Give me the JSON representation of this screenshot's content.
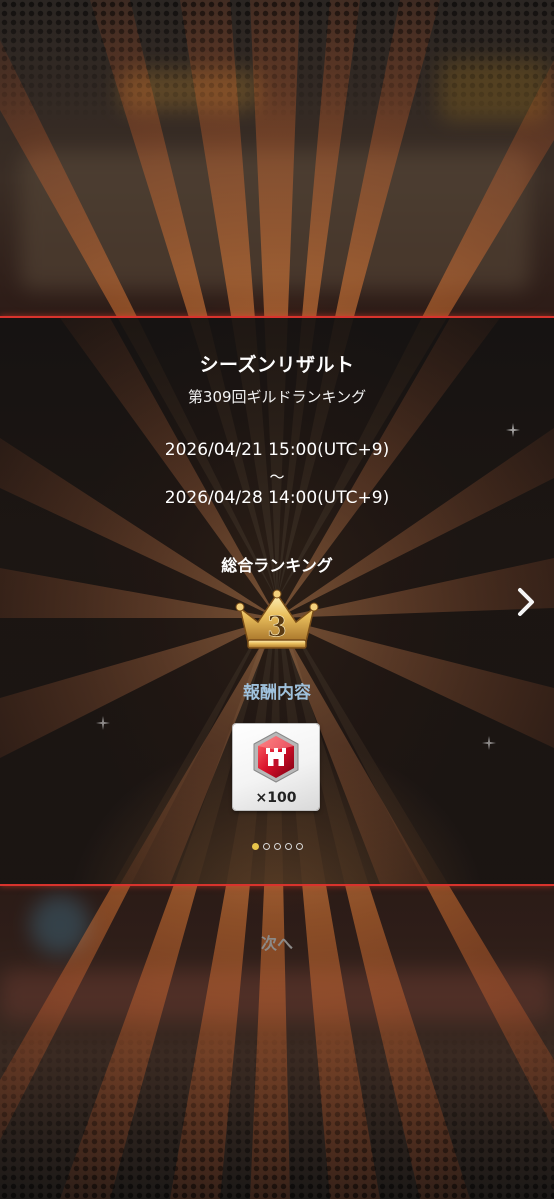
{
  "result": {
    "title": "シーズンリザルト",
    "subtitle": "第309回ギルドランキング",
    "period_start": "2026/04/21 15:00(UTC+9)",
    "period_separator": "～",
    "period_end": "2026/04/28 14:00(UTC+9)",
    "ranking_label": "総合ランキング",
    "rank": "3",
    "reward_label": "報酬内容",
    "reward": {
      "icon": "guild-castle-gem-icon",
      "quantity": "×100"
    },
    "pager": {
      "total": 5,
      "current": 1
    }
  },
  "footer": {
    "next_label": "次へ"
  },
  "colors": {
    "accent_red": "#d8332d",
    "reward_label": "#9fc1dc",
    "crown_gold": "#e0b24a",
    "pager_active": "#e7c44a"
  }
}
